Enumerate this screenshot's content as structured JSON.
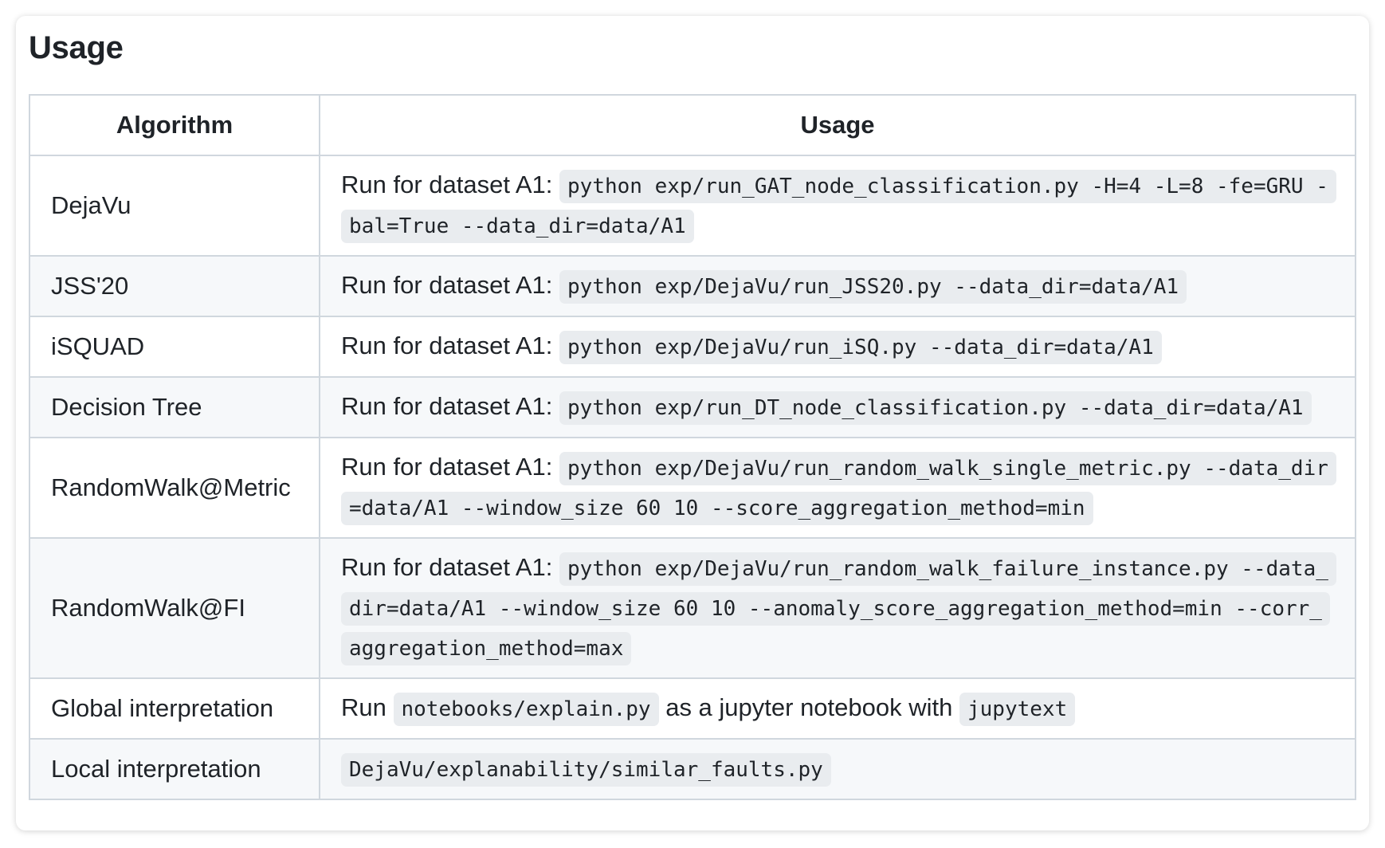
{
  "heading": "Usage",
  "table": {
    "headers": {
      "algorithm": "Algorithm",
      "usage": "Usage"
    },
    "rows": [
      {
        "algorithm": "DejaVu",
        "prefix": "Run for dataset A1:",
        "command": "python exp/run_GAT_node_classification.py -H=4 -L=8 -fe=GRU -bal=True --data_dir=data/A1"
      },
      {
        "algorithm": "JSS'20",
        "prefix": "Run for dataset A1:",
        "command": "python exp/DejaVu/run_JSS20.py --data_dir=data/A1"
      },
      {
        "algorithm": "iSQUAD",
        "prefix": "Run for dataset A1:",
        "command": "python exp/DejaVu/run_iSQ.py --data_dir=data/A1"
      },
      {
        "algorithm": "Decision Tree",
        "prefix": "Run for dataset A1:",
        "command": "python exp/run_DT_node_classification.py --data_dir=data/A1"
      },
      {
        "algorithm": "RandomWalk@Metric",
        "prefix": "Run for dataset A1:",
        "command": "python exp/DejaVu/run_random_walk_single_metric.py --data_dir=data/A1 --window_size 60 10 --score_aggregation_method=min"
      },
      {
        "algorithm": "RandomWalk@FI",
        "prefix": "Run for dataset A1:",
        "command": "python exp/DejaVu/run_random_walk_failure_instance.py --data_dir=data/A1 --window_size 60 10 --anomaly_score_aggregation_method=min --corr_aggregation_method=max"
      }
    ],
    "global_interpretation": {
      "algorithm": "Global interpretation",
      "text_run": "Run",
      "code_notebook": "notebooks/explain.py",
      "text_middle": "as a jupyter notebook with",
      "code_tool": "jupytext"
    },
    "local_interpretation": {
      "algorithm": "Local interpretation",
      "code": "DejaVu/explanability/similar_faults.py"
    }
  }
}
